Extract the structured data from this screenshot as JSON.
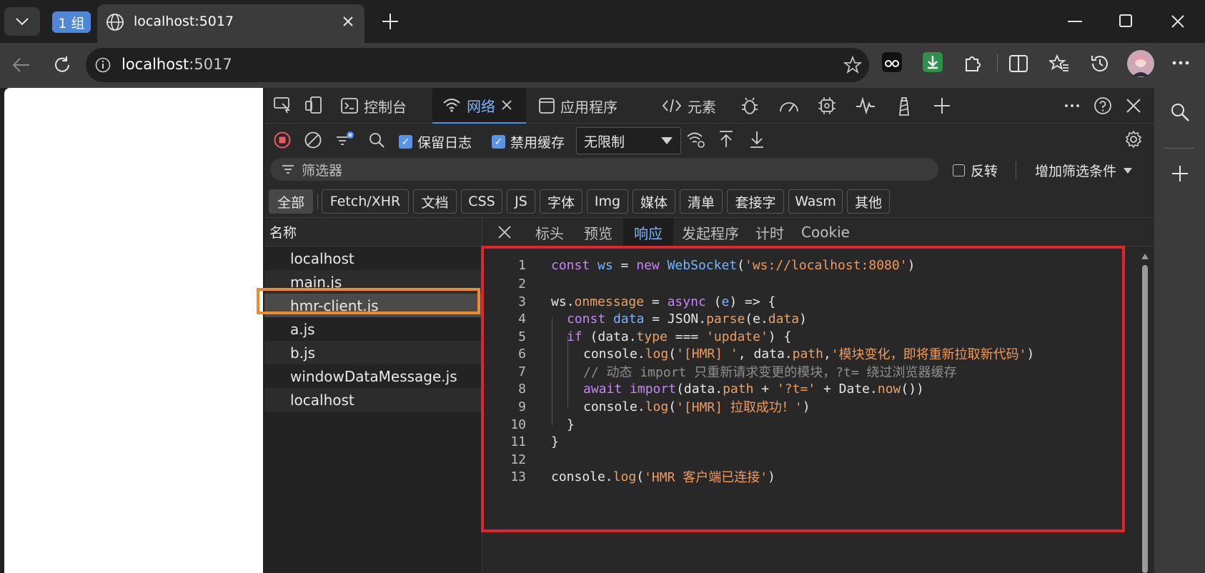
{
  "titlebar": {
    "group_label": "1 组",
    "tab_title": "localhost:5017"
  },
  "address": {
    "host": "localhost",
    "port": ":5017"
  },
  "devtools": {
    "tabs": [
      {
        "label": "控制台"
      },
      {
        "label": "网络"
      },
      {
        "label": "应用程序"
      },
      {
        "label": "元素"
      }
    ],
    "toolbar": {
      "preserve_log_label": "保留日志",
      "disable_cache_label": "禁用缓存",
      "throttle_value": "无限制"
    },
    "filter": {
      "placeholder": "筛选器",
      "invert_label": "反转",
      "more_filters_label": "增加筛选条件"
    },
    "chips": [
      "全部",
      "Fetch/XHR",
      "文档",
      "CSS",
      "JS",
      "字体",
      "Img",
      "媒体",
      "清单",
      "套接字",
      "Wasm",
      "其他"
    ],
    "request_list": {
      "header": "名称",
      "items": [
        "localhost",
        "main.js",
        "hmr-client.js",
        "a.js",
        "b.js",
        "windowDataMessage.js",
        "localhost"
      ]
    },
    "detail_tabs": [
      "标头",
      "预览",
      "响应",
      "发起程序",
      "计时",
      "Cookie"
    ],
    "code_line_numbers": [
      "1",
      "2",
      "3",
      "4",
      "5",
      "6",
      "7",
      "8",
      "9",
      "10",
      "11",
      "12",
      "13"
    ],
    "code": {
      "l1": [
        "const",
        " ",
        "ws",
        " = ",
        "new",
        " ",
        "WebSocket",
        "(",
        "'ws://localhost:8080'",
        ")"
      ],
      "l3": [
        "ws",
        ".",
        "onmessage",
        " = ",
        "async",
        " (",
        "e",
        ") => {"
      ],
      "l4": [
        "const",
        " ",
        "data",
        " = JSON.",
        "parse",
        "(e.",
        "data",
        ")"
      ],
      "l5": [
        "if",
        " (data.",
        "type",
        " === ",
        "'update'",
        ") {"
      ],
      "l6": [
        "console.",
        "log",
        "(",
        "'[HMR] '",
        ", data.",
        "path",
        ",",
        "'模块变化，即将重新拉取新代码'",
        ")"
      ],
      "l7": [
        "// 动态 import 只重新请求变更的模块，?t= 绕过浏览器缓存"
      ],
      "l8": [
        "await",
        " ",
        "import",
        "(data.",
        "path",
        " + ",
        "'?t='",
        " + Date.",
        "now",
        "())"
      ],
      "l9": [
        "console.",
        "log",
        "(",
        "'[HMR] 拉取成功！'",
        ")"
      ],
      "l10": [
        "}"
      ],
      "l11": [
        "}"
      ],
      "l13": [
        "console.",
        "log",
        "(",
        "'HMR 客户端已连接'",
        ")"
      ]
    }
  },
  "colors": {
    "highlight_red": "#e0262b",
    "highlight_orange": "#f08a2a",
    "accent": "#4a90f7"
  }
}
